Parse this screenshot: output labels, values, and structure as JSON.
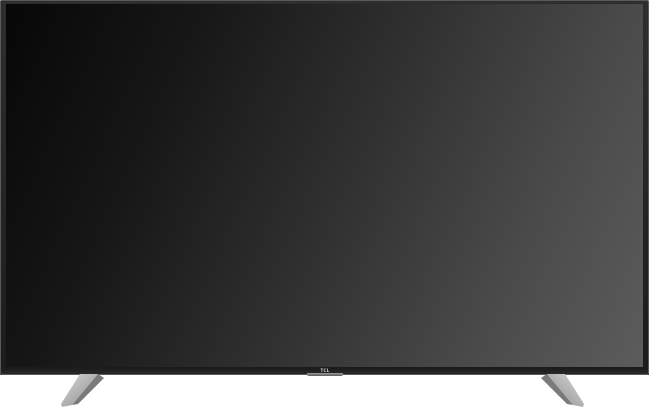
{
  "device": {
    "type": "television",
    "brand_logo": "TCL",
    "screen_state": "off"
  },
  "colors": {
    "bezel": "#1c1c1c",
    "screen_dark": "#070707",
    "screen_light": "#5c5c5c",
    "stand": "#a9a9a9",
    "background": "#ffffff"
  }
}
